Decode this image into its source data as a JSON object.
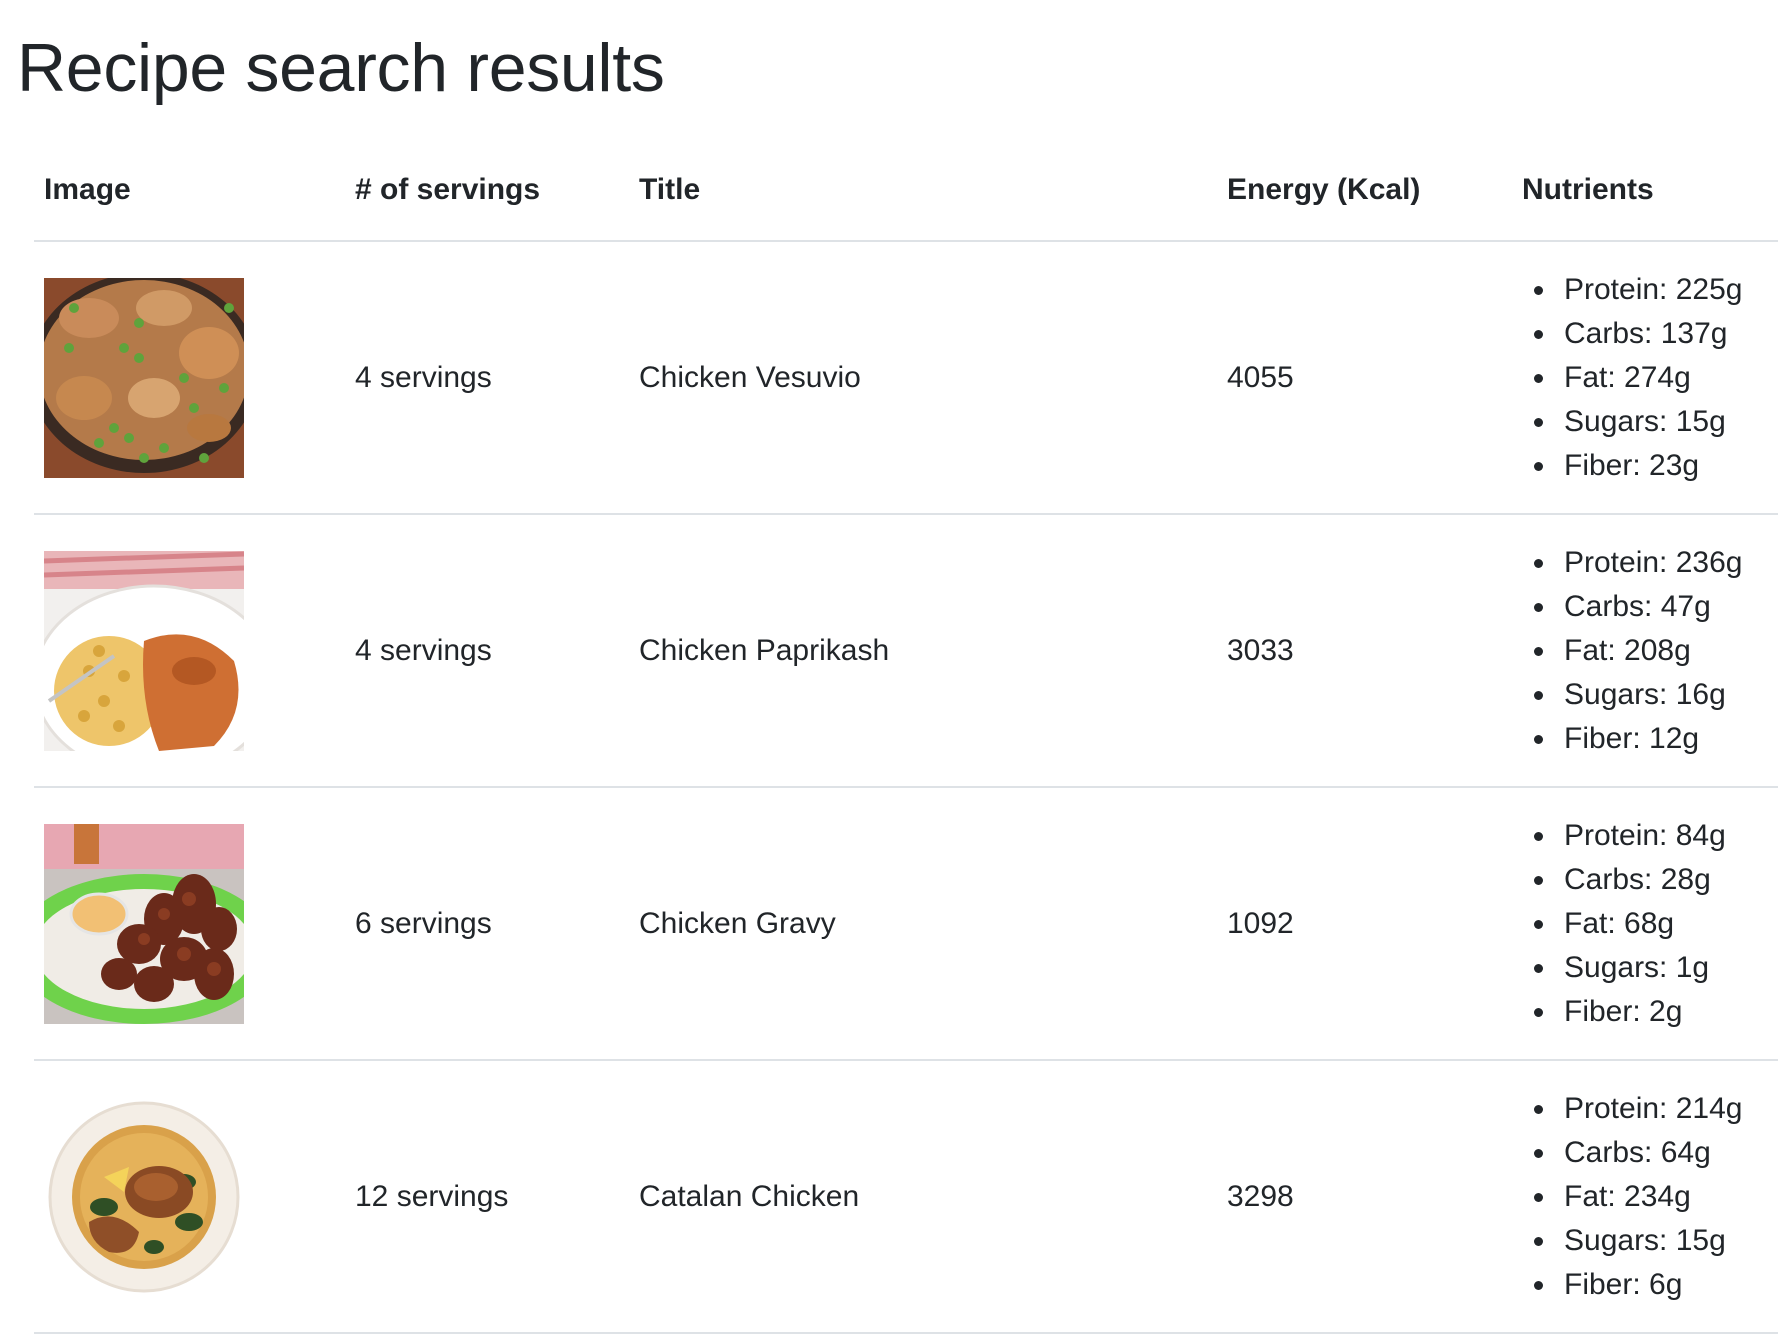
{
  "page": {
    "title": "Recipe search results"
  },
  "table": {
    "headers": {
      "image": "Image",
      "servings": "# of servings",
      "title": "Title",
      "energy": "Energy (Kcal)",
      "nutrients": "Nutrients"
    },
    "rows": [
      {
        "image_icon": "chicken-vesuvio-photo",
        "servings": "4 servings",
        "title": "Chicken Vesuvio",
        "energy": "4055",
        "nutrients": [
          "Protein: 225g",
          "Carbs: 137g",
          "Fat: 274g",
          "Sugars: 15g",
          "Fiber: 23g"
        ]
      },
      {
        "image_icon": "chicken-paprikash-photo",
        "servings": "4 servings",
        "title": "Chicken Paprikash",
        "energy": "3033",
        "nutrients": [
          "Protein: 236g",
          "Carbs: 47g",
          "Fat: 208g",
          "Sugars: 16g",
          "Fiber: 12g"
        ]
      },
      {
        "image_icon": "chicken-gravy-photo",
        "servings": "6 servings",
        "title": "Chicken Gravy",
        "energy": "1092",
        "nutrients": [
          "Protein: 84g",
          "Carbs: 28g",
          "Fat: 68g",
          "Sugars: 1g",
          "Fiber: 2g"
        ]
      },
      {
        "image_icon": "catalan-chicken-photo",
        "servings": "12 servings",
        "title": "Catalan Chicken",
        "energy": "3298",
        "nutrients": [
          "Protein: 214g",
          "Carbs: 64g",
          "Fat: 234g",
          "Sugars: 15g",
          "Fiber: 6g"
        ]
      }
    ]
  },
  "colors": {
    "text": "#212529",
    "border": "#dee2e6",
    "background": "#ffffff"
  }
}
